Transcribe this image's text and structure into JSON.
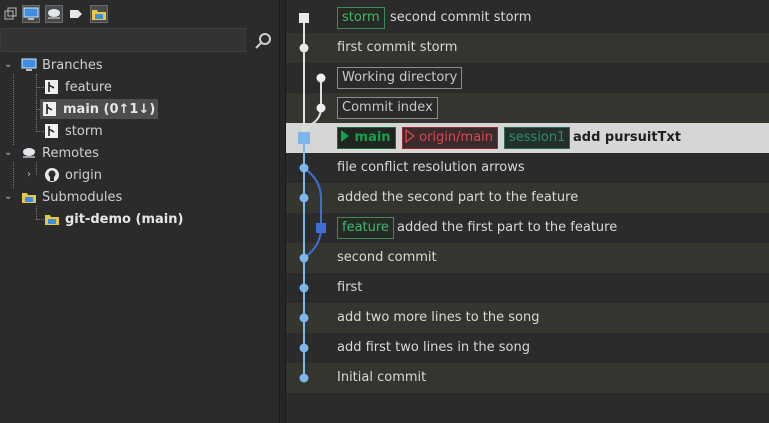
{
  "colors": {
    "graph_line": "#7cb6ea",
    "graph_branch": "#3d6fd6",
    "head_bg": "#d6d6d6",
    "accent_green": "#3fb86a",
    "accent_red": "#d84a52"
  },
  "toolbar": {
    "icons": [
      "local-branches-icon",
      "remotes-icon",
      "tags-icon",
      "submodules-icon"
    ]
  },
  "search": {
    "placeholder": "",
    "value": ""
  },
  "tree": {
    "branches_label": "Branches",
    "branches": [
      {
        "label": "feature",
        "current": false
      },
      {
        "label": "main (0↑1↓)",
        "current": true
      },
      {
        "label": "storm",
        "current": false
      }
    ],
    "remotes_label": "Remotes",
    "remotes": [
      {
        "label": "origin"
      }
    ],
    "submodules_label": "Submodules",
    "submodules": [
      {
        "label": "git-demo (main)"
      }
    ]
  },
  "commits": [
    {
      "message": "second commit storm",
      "refs": [
        {
          "text": "storm",
          "kind": "branch"
        }
      ]
    },
    {
      "message": "first commit storm",
      "refs": []
    },
    {
      "message": "",
      "refs": [
        {
          "text": "Working directory",
          "kind": "virtual"
        }
      ]
    },
    {
      "message": "",
      "refs": [
        {
          "text": "Commit index",
          "kind": "virtual"
        }
      ]
    },
    {
      "message": "add pursuitTxt",
      "refs": [
        {
          "text": "main",
          "kind": "head"
        },
        {
          "text": "origin/main",
          "kind": "remote"
        },
        {
          "text": "session1",
          "kind": "tag"
        }
      ]
    },
    {
      "message": "file conflict resolution arrows",
      "refs": []
    },
    {
      "message": "added the second part to the feature",
      "refs": []
    },
    {
      "message": "added the first part to the feature",
      "refs": [
        {
          "text": "feature",
          "kind": "branch"
        }
      ]
    },
    {
      "message": "second commit",
      "refs": []
    },
    {
      "message": "first",
      "refs": []
    },
    {
      "message": "add two more lines to the song",
      "refs": []
    },
    {
      "message": "add first two lines in the song",
      "refs": []
    },
    {
      "message": "Initial commit",
      "refs": []
    }
  ]
}
